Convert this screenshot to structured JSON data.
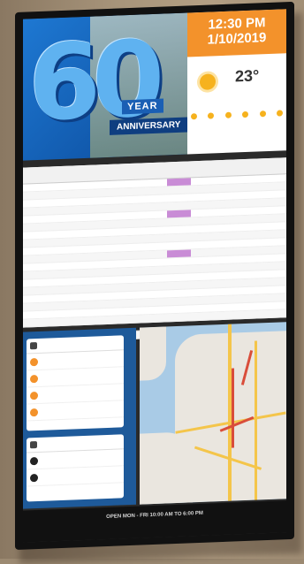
{
  "clock": {
    "time": "12:30 PM",
    "date": "1/10/2019"
  },
  "hero": {
    "number": "60",
    "year": "YEAR",
    "anniversary": "ANNIVERSARY"
  },
  "weather": {
    "temp": "23°"
  },
  "footer": {
    "line1": "OPEN MON - FRI 10:00 AM TO 6:00 PM"
  }
}
